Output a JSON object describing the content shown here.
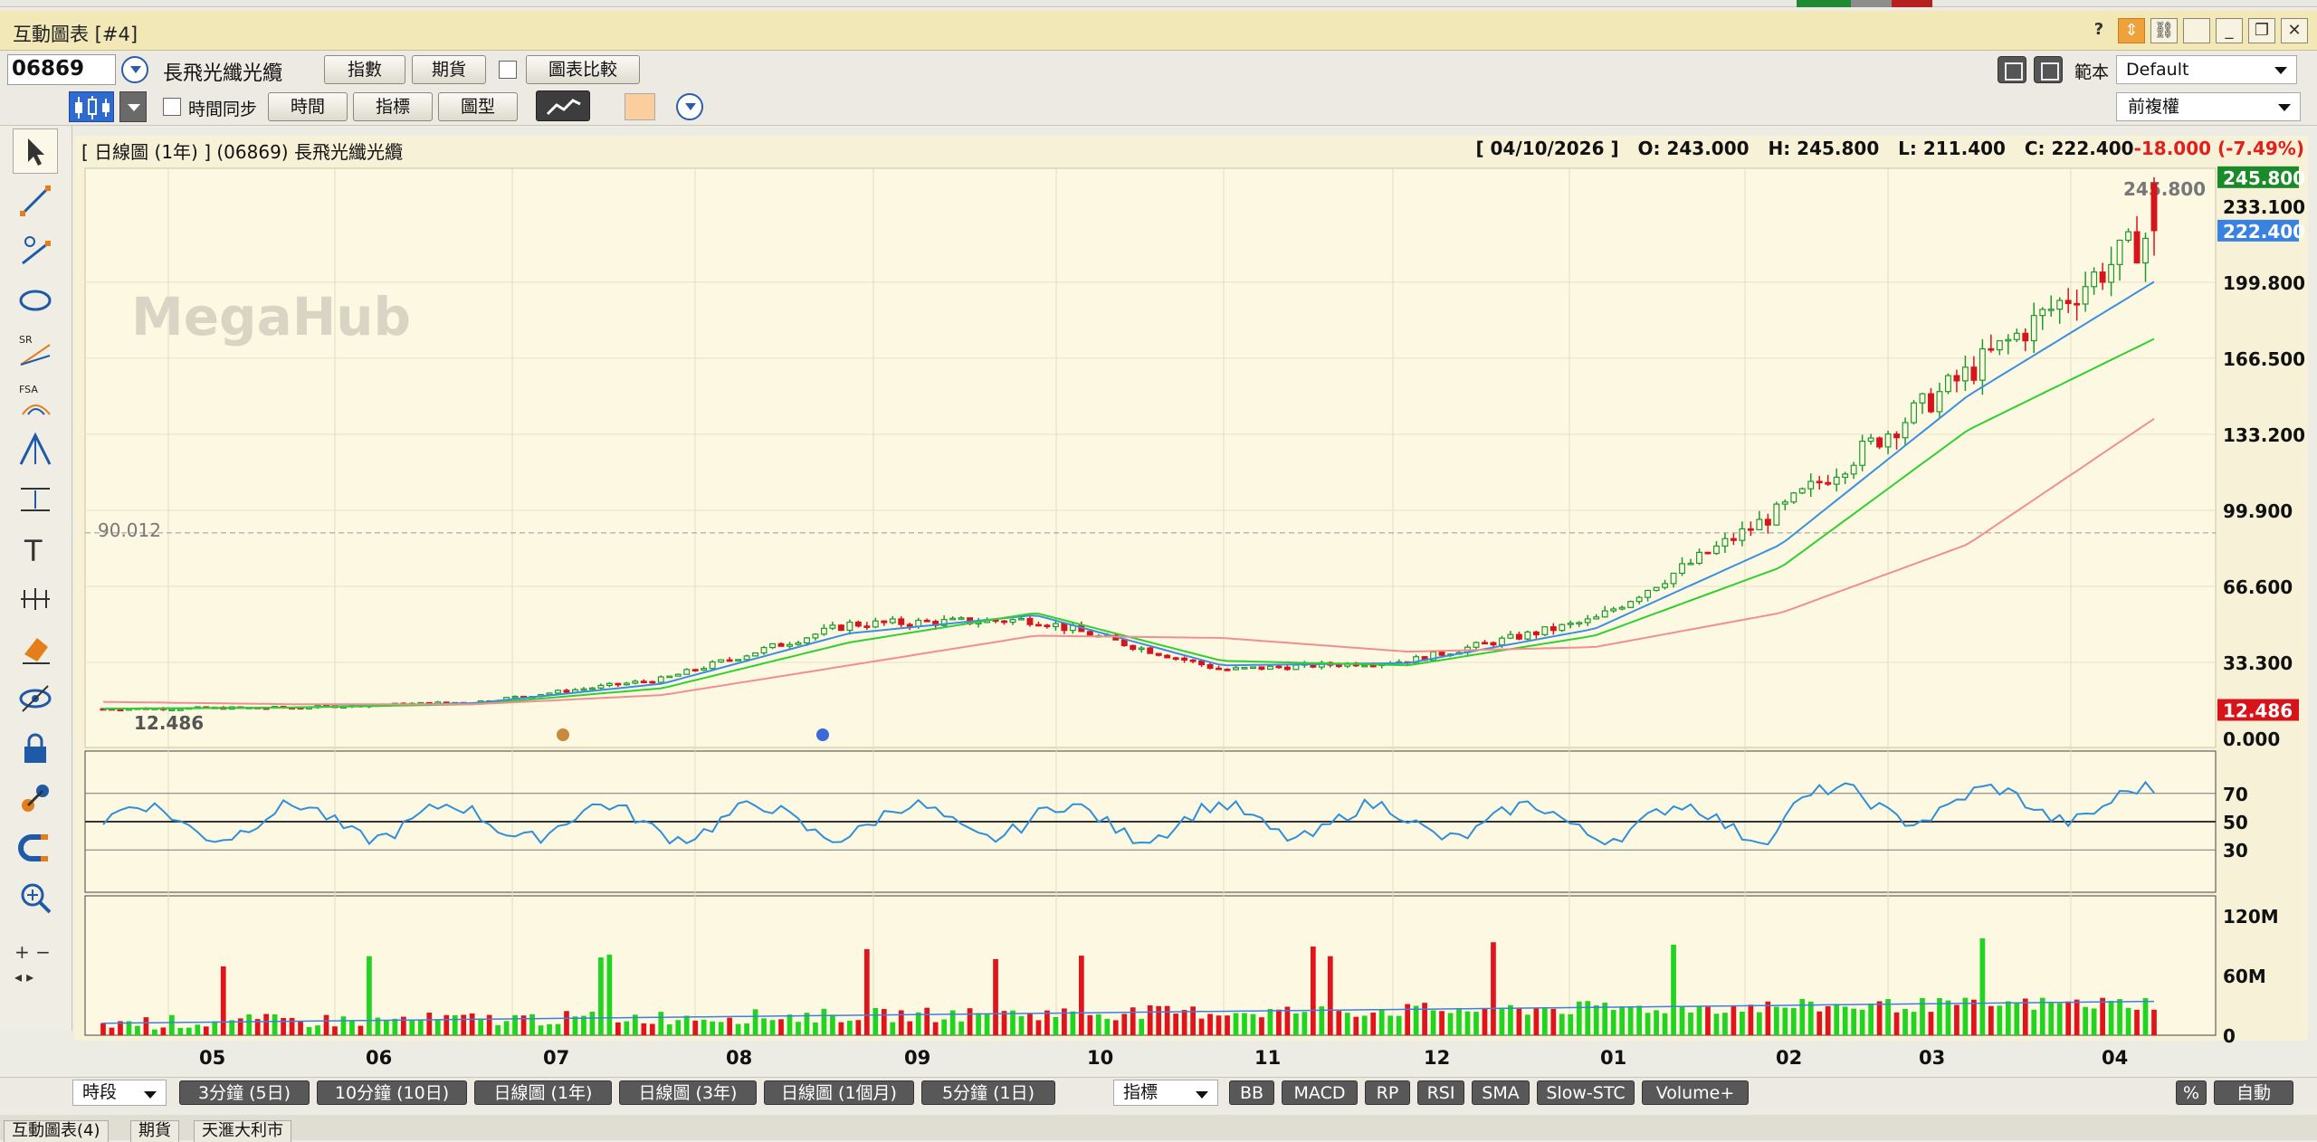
{
  "window": {
    "title": "互動圖表 [#4]"
  },
  "toolbar1": {
    "code": "06869",
    "stock_name": "長飛光纖光纜",
    "btn_index": "指數",
    "btn_futures": "期貨",
    "btn_compare": "圖表比較",
    "template_label": "範本",
    "template_value": "Default"
  },
  "toolbar2": {
    "time_sync_label": "時間同步",
    "btn_time": "時間",
    "btn_indicator": "指標",
    "btn_chart_type": "圖型",
    "adjust_value": "前複權"
  },
  "chart": {
    "header": "[ 日線圖 (1年) ]  (06869)  長飛光纖光纜",
    "date": "[ 04/10/2026 ]",
    "open": "O: 243.000",
    "high": "H: 245.800",
    "low": "L: 211.400",
    "close": "C: 222.400",
    "change": "-18.000 (-7.49%)",
    "watermark": "MegaHub",
    "ref_line_label": "90.012",
    "low_marker": "12.486",
    "high_marker": "245.800",
    "price_tags": {
      "high": "245.800",
      "ma": "233.100",
      "close": "222.400",
      "low": "12.486"
    },
    "y_ticks": [
      "199.800",
      "166.500",
      "133.200",
      "99.900",
      "66.600",
      "33.300",
      "0.000"
    ],
    "rsi_ticks": [
      "70",
      "50",
      "30"
    ],
    "vol_ticks": [
      "120M",
      "60M",
      "0"
    ],
    "x_ticks": [
      "05",
      "06",
      "07",
      "08",
      "09",
      "10",
      "11",
      "12",
      "01",
      "02",
      "03",
      "04"
    ]
  },
  "chart_data": {
    "type": "candlestick",
    "title": "",
    "xlabel": "",
    "ylabel": "",
    "ylim": [
      0,
      260
    ],
    "x": [
      "05",
      "06",
      "07",
      "08",
      "09",
      "10",
      "11",
      "12",
      "01",
      "02",
      "03",
      "04"
    ],
    "series": [
      {
        "name": "Close",
        "values": [
          13,
          13.5,
          16,
          26,
          50,
          52,
          30,
          34,
          52,
          100,
          160,
          222.4
        ]
      },
      {
        "name": "MA Blue",
        "values": [
          13,
          13.5,
          15.5,
          24,
          46,
          54,
          32,
          33,
          48,
          85,
          150,
          200
        ]
      },
      {
        "name": "MA Green",
        "values": [
          13,
          13.5,
          15,
          22,
          42,
          55,
          34,
          32,
          45,
          75,
          135,
          175
        ]
      },
      {
        "name": "MA Red",
        "values": [
          16,
          15,
          15,
          19,
          32,
          45,
          44,
          38,
          40,
          55,
          85,
          140
        ]
      }
    ],
    "rsi_ylim": [
      0,
      100
    ],
    "volume_ylim_millions": [
      0,
      140
    ],
    "grid": true
  },
  "bottom": {
    "period_select": "時段",
    "ranges": [
      "3分鐘 (5日)",
      "10分鐘 (10日)",
      "日線圖 (1年)",
      "日線圖 (3年)",
      "日線圖 (1個月)",
      "5分鐘 (1日)"
    ],
    "indicator_select": "指標",
    "indicators": [
      "BB",
      "MACD",
      "RP",
      "RSI",
      "SMA",
      "Slow-STC",
      "Volume+"
    ],
    "pct": "%",
    "auto": "自動"
  },
  "tabs": [
    "互動圖表(4)",
    "期貨",
    "天滙大利市"
  ]
}
